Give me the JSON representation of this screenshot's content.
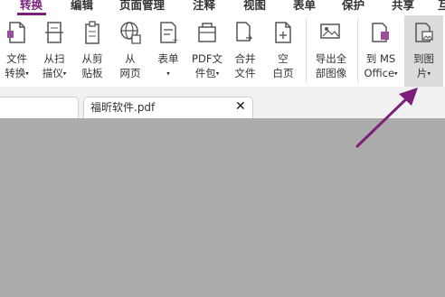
{
  "menu": {
    "convert": "转换",
    "edit": "编辑",
    "page_manage": "页面管理",
    "annotate": "注释",
    "view": "视图",
    "form": "表单",
    "protect": "保护",
    "share": "共享",
    "more": "互"
  },
  "ribbon": {
    "file_convert": {
      "l1": "文件",
      "l2": "转换"
    },
    "from_scan": {
      "l1": "从扫",
      "l2": "描仪"
    },
    "from_clipboard": {
      "l1": "从剪",
      "l2": "贴板"
    },
    "from_webpage": {
      "l1": "从",
      "l2": "网页"
    },
    "form": {
      "l1": "表单"
    },
    "pdf_package": {
      "l1": "PDF文",
      "l2": "件包"
    },
    "merge": {
      "l1": "合并",
      "l2": "文件"
    },
    "blank_page": {
      "l1": "空",
      "l2": "白页"
    },
    "export_images": {
      "l1": "导出全",
      "l2": "部图像"
    },
    "to_ms_office": {
      "l1": "到 MS",
      "l2": "Office"
    },
    "to_image": {
      "l1": "到图",
      "l2": "片"
    },
    "dropdown_glyph": "▾"
  },
  "tabs": {
    "document_title": "福昕软件.pdf",
    "close_glyph": "✕"
  },
  "colors": {
    "accent": "#7b1f7b",
    "ribbon_bg": "#ffffff",
    "workspace_bg": "#ababab",
    "highlight_bg": "#dcdcdc"
  }
}
